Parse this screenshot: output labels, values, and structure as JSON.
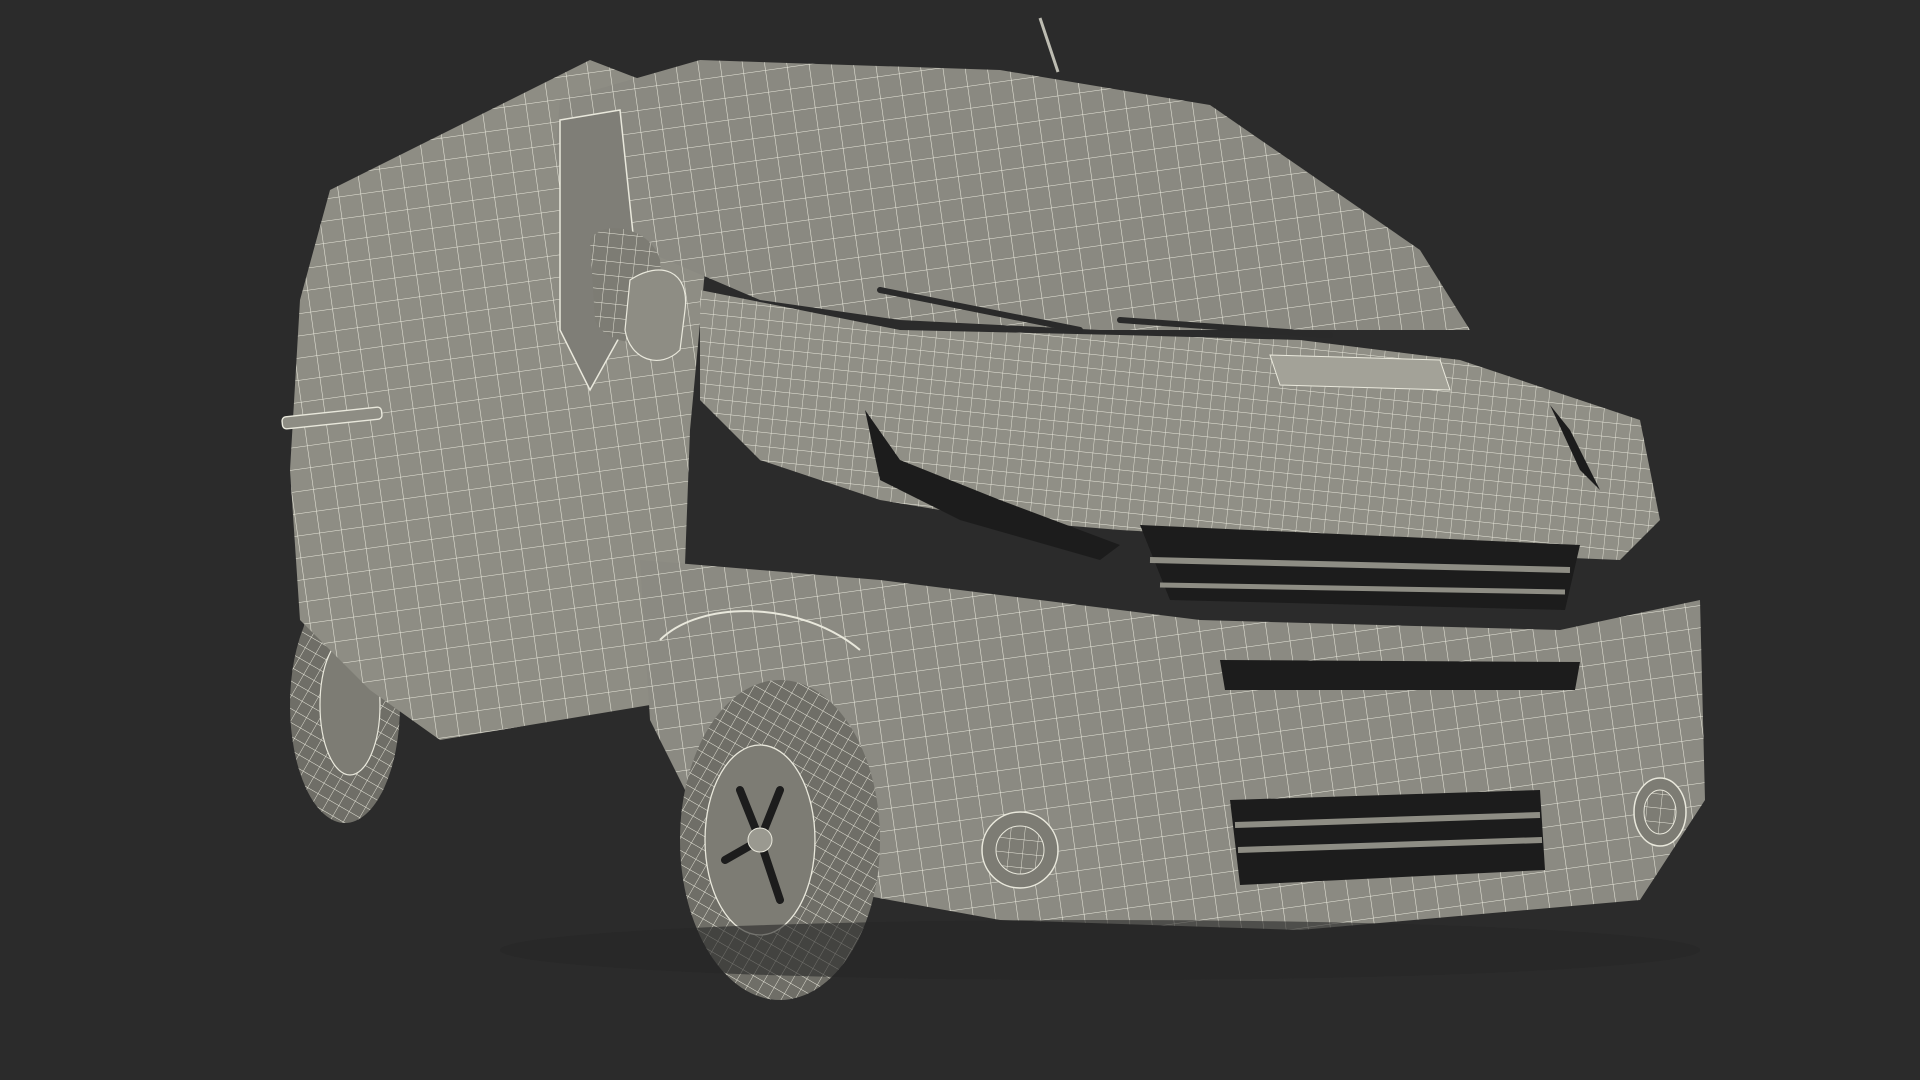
{
  "scene": {
    "background_color": "#2b2b2b",
    "surface_color": "#8e8d84",
    "surface_shadow_color": "#6f6e67",
    "wire_color": "#e9e8dc",
    "dark_opening_color": "#1c1c1c",
    "subject": "van-wireframe-icon"
  }
}
